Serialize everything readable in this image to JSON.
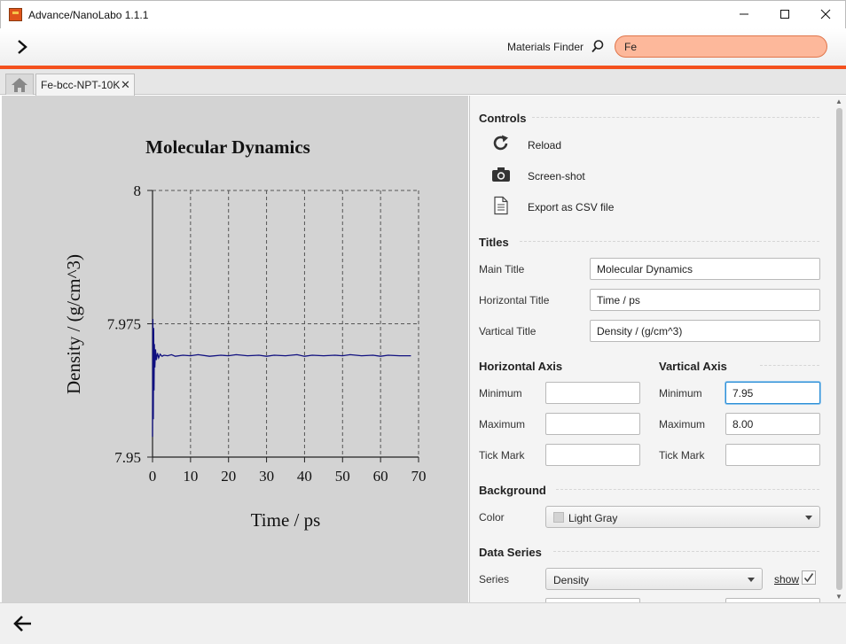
{
  "window": {
    "title": "Advance/NanoLabo 1.1.1"
  },
  "toolbar": {
    "expand_icon": "chevron-right-icon",
    "finder_label": "Materials Finder",
    "finder_icon": "search-icon",
    "search_value": "Fe"
  },
  "tabs": {
    "home_icon": "home-icon",
    "active_tab_label": "Fe-bcc-NPT-10K",
    "close_glyph": "✕"
  },
  "colors": {
    "accent": "#f4511e",
    "search_bg": "#fdb89b",
    "chart_bg": "#d3d3d3",
    "series_line": "#101080"
  },
  "chart_data": {
    "type": "line",
    "title": "Molecular Dynamics",
    "xlabel": "Time / ps",
    "ylabel": "Density / (g/cm^3)",
    "xlim": [
      0,
      70
    ],
    "ylim": [
      7.95,
      8.0
    ],
    "x_ticks": [
      "0",
      "10",
      "20",
      "30",
      "40",
      "50",
      "60",
      "70"
    ],
    "y_ticks": [
      "7.95",
      "7.975",
      "8"
    ],
    "grid": true,
    "series": [
      {
        "name": "Density",
        "x": [
          0,
          0.1,
          0.2,
          0.3,
          0.4,
          0.5,
          0.6,
          0.8,
          1.0,
          1.3,
          1.6,
          2.0,
          2.5,
          3,
          4,
          5,
          6,
          8,
          10,
          12,
          15,
          18,
          20,
          22,
          25,
          28,
          30,
          32,
          35,
          38,
          40,
          42,
          45,
          48,
          50,
          52,
          55,
          58,
          60,
          62,
          65,
          68
        ],
        "values": [
          7.9538,
          7.9759,
          7.9571,
          7.9742,
          7.9625,
          7.9712,
          7.9668,
          7.9702,
          7.9682,
          7.9695,
          7.9686,
          7.9693,
          7.9689,
          7.9691,
          7.969,
          7.9692,
          7.9689,
          7.9691,
          7.969,
          7.9692,
          7.9689,
          7.9691,
          7.969,
          7.9692,
          7.969,
          7.9691,
          7.9689,
          7.9691,
          7.969,
          7.9692,
          7.9689,
          7.9691,
          7.969,
          7.9691,
          7.969,
          7.9692,
          7.969,
          7.9691,
          7.9689,
          7.9691,
          7.969,
          7.969
        ]
      }
    ]
  },
  "controls": {
    "section_title": "Controls",
    "reload": {
      "label": "Reload",
      "icon": "reload-icon"
    },
    "screenshot": {
      "label": "Screen-shot",
      "icon": "camera-icon"
    },
    "export_csv": {
      "label": "Export as CSV file",
      "icon": "document-icon"
    }
  },
  "titles": {
    "section_title": "Titles",
    "main_title": {
      "label": "Main Title",
      "value": "Molecular Dynamics"
    },
    "horizontal_title": {
      "label": "Horizontal Title",
      "value": "Time / ps"
    },
    "vertical_title": {
      "label": "Vartical Title",
      "value": "Density / (g/cm^3)"
    }
  },
  "horizontal_axis": {
    "section_title": "Horizontal Axis",
    "minimum": {
      "label": "Minimum",
      "value": ""
    },
    "maximum": {
      "label": "Maximum",
      "value": ""
    },
    "tick_mark": {
      "label": "Tick Mark",
      "value": ""
    }
  },
  "vertical_axis": {
    "section_title": "Vartical Axis",
    "minimum": {
      "label": "Minimum",
      "value": "7.95"
    },
    "maximum": {
      "label": "Maximum",
      "value": "8.00"
    },
    "tick_mark": {
      "label": "Tick Mark",
      "value": ""
    }
  },
  "background": {
    "section_title": "Background",
    "color_label": "Color",
    "color_value": "Light Gray"
  },
  "data_series": {
    "section_title": "Data Series",
    "series_label": "Series",
    "series_value": "Density",
    "show_label": "show",
    "show_checked": true
  },
  "bottom": {
    "back_icon": "arrow-left-icon"
  }
}
